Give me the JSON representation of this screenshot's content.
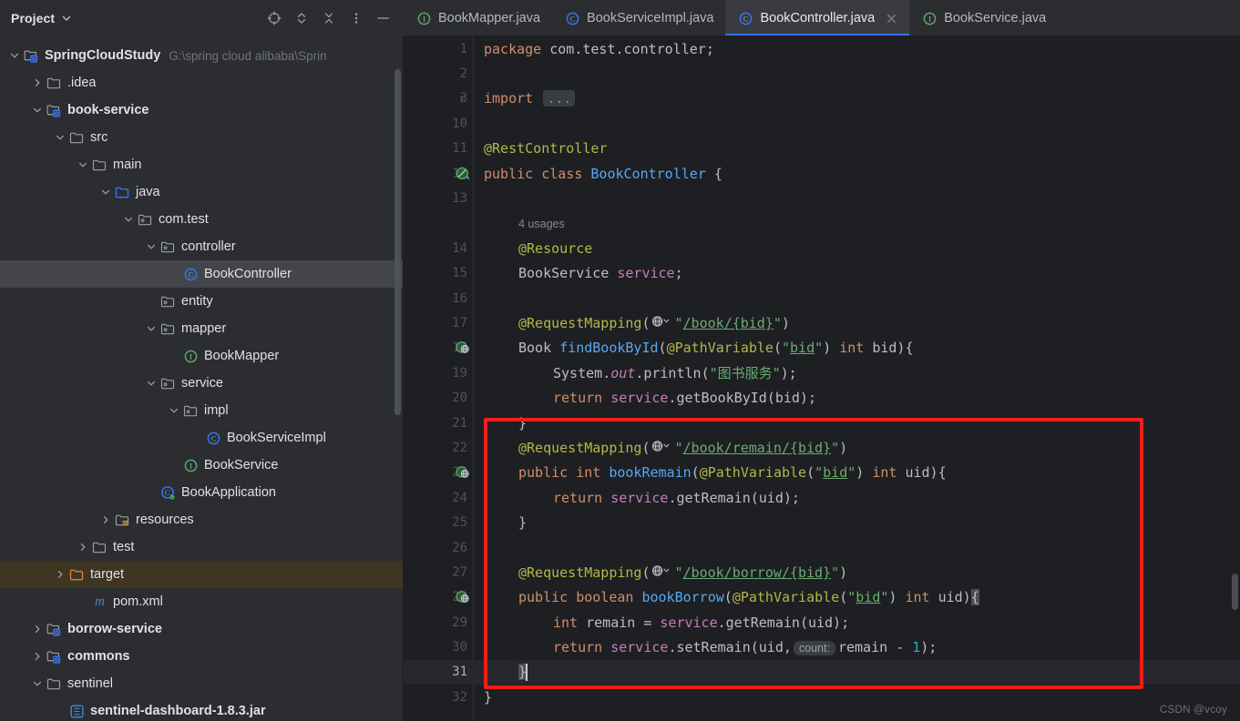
{
  "window": {
    "theme_bg": "#2b2d30",
    "editor_bg": "#1e1f22",
    "accent": "#3574f0",
    "annotation_color": "#ff1a1a"
  },
  "project_panel": {
    "title": "Project",
    "toolbar": [
      {
        "name": "locate-icon",
        "label": "Select Opened File"
      },
      {
        "name": "expand-collapse-icon",
        "label": "Expand/Collapse"
      },
      {
        "name": "collapse-all-icon",
        "label": "Collapse All"
      },
      {
        "name": "more-options-icon",
        "label": "Options"
      },
      {
        "name": "minimize-icon",
        "label": "Hide"
      }
    ],
    "tree": [
      {
        "label": "SpringCloudStudy",
        "sub": "G:\\spring cloud alibaba\\Sprin",
        "depth": 0,
        "icon": "module-icon",
        "arrow": "down",
        "bold": true,
        "state": "normal"
      },
      {
        "label": ".idea",
        "sub": "",
        "depth": 1,
        "icon": "folder-icon",
        "arrow": "right",
        "bold": false,
        "state": "normal"
      },
      {
        "label": "book-service",
        "sub": "",
        "depth": 1,
        "icon": "module-icon",
        "arrow": "down",
        "bold": true,
        "state": "normal"
      },
      {
        "label": "src",
        "sub": "",
        "depth": 2,
        "icon": "folder-icon",
        "arrow": "down",
        "bold": false,
        "state": "normal"
      },
      {
        "label": "main",
        "sub": "",
        "depth": 3,
        "icon": "folder-icon",
        "arrow": "down",
        "bold": false,
        "state": "normal"
      },
      {
        "label": "java",
        "sub": "",
        "depth": 4,
        "icon": "source-folder-icon",
        "arrow": "down",
        "bold": false,
        "state": "normal"
      },
      {
        "label": "com.test",
        "sub": "",
        "depth": 5,
        "icon": "package-icon",
        "arrow": "down",
        "bold": false,
        "state": "normal"
      },
      {
        "label": "controller",
        "sub": "",
        "depth": 6,
        "icon": "package-icon",
        "arrow": "down",
        "bold": false,
        "state": "normal"
      },
      {
        "label": "BookController",
        "sub": "",
        "depth": 7,
        "icon": "class-icon",
        "arrow": "none",
        "bold": false,
        "state": "selected"
      },
      {
        "label": "entity",
        "sub": "",
        "depth": 6,
        "icon": "package-icon",
        "arrow": "none",
        "bold": false,
        "state": "normal"
      },
      {
        "label": "mapper",
        "sub": "",
        "depth": 6,
        "icon": "package-icon",
        "arrow": "down",
        "bold": false,
        "state": "normal"
      },
      {
        "label": "BookMapper",
        "sub": "",
        "depth": 7,
        "icon": "interface-icon",
        "arrow": "none",
        "bold": false,
        "state": "normal"
      },
      {
        "label": "service",
        "sub": "",
        "depth": 6,
        "icon": "package-icon",
        "arrow": "down",
        "bold": false,
        "state": "normal"
      },
      {
        "label": "impl",
        "sub": "",
        "depth": 7,
        "icon": "package-icon",
        "arrow": "down",
        "bold": false,
        "state": "normal"
      },
      {
        "label": "BookServiceImpl",
        "sub": "",
        "depth": 8,
        "icon": "class-icon",
        "arrow": "none",
        "bold": false,
        "state": "normal"
      },
      {
        "label": "BookService",
        "sub": "",
        "depth": 7,
        "icon": "interface-icon",
        "arrow": "none",
        "bold": false,
        "state": "normal"
      },
      {
        "label": "BookApplication",
        "sub": "",
        "depth": 6,
        "icon": "spring-class-icon",
        "arrow": "none",
        "bold": false,
        "state": "normal"
      },
      {
        "label": "resources",
        "sub": "",
        "depth": 4,
        "icon": "resource-folder-icon",
        "arrow": "right",
        "bold": false,
        "state": "normal"
      },
      {
        "label": "test",
        "sub": "",
        "depth": 3,
        "icon": "folder-icon",
        "arrow": "right",
        "bold": false,
        "state": "normal"
      },
      {
        "label": "target",
        "sub": "",
        "depth": 2,
        "icon": "excluded-folder-icon",
        "arrow": "right",
        "bold": false,
        "state": "marked"
      },
      {
        "label": "pom.xml",
        "sub": "",
        "depth": 3,
        "icon": "maven-icon",
        "arrow": "none",
        "bold": false,
        "state": "normal"
      },
      {
        "label": "borrow-service",
        "sub": "",
        "depth": 1,
        "icon": "module-icon",
        "arrow": "right",
        "bold": true,
        "state": "normal"
      },
      {
        "label": "commons",
        "sub": "",
        "depth": 1,
        "icon": "module-icon",
        "arrow": "right",
        "bold": true,
        "state": "normal"
      },
      {
        "label": "sentinel",
        "sub": "",
        "depth": 1,
        "icon": "folder-icon",
        "arrow": "down",
        "bold": false,
        "state": "normal"
      },
      {
        "label": "sentinel-dashboard-1.8.3.jar",
        "sub": "",
        "depth": 2,
        "icon": "jar-icon",
        "arrow": "none",
        "bold": true,
        "state": "normal"
      }
    ]
  },
  "editor_tabs": [
    {
      "label": "BookMapper.java",
      "icon": "interface-icon",
      "active": false,
      "closable": false
    },
    {
      "label": "BookServiceImpl.java",
      "icon": "class-icon",
      "active": false,
      "closable": false
    },
    {
      "label": "BookController.java",
      "icon": "class-icon",
      "active": true,
      "closable": true
    },
    {
      "label": "BookService.java",
      "icon": "interface-icon",
      "active": false,
      "closable": false
    }
  ],
  "code": {
    "filename": "BookController.java",
    "lines": [
      {
        "num": "1",
        "gutter_icon": "",
        "indent": 0,
        "html": "<span class='kw'>package</span> <span class='pkg'>com.test.controller</span>;"
      },
      {
        "num": "2",
        "gutter_icon": "",
        "indent": 0,
        "html": ""
      },
      {
        "num": "3",
        "gutter_icon": "",
        "indent": 0,
        "fold": true,
        "html": "<span class='kw'>import</span> <span class='fold-ph'>...</span>"
      },
      {
        "num": "10",
        "gutter_icon": "",
        "indent": 0,
        "html": ""
      },
      {
        "num": "11",
        "gutter_icon": "",
        "indent": 0,
        "html": "<span class='ann'>@RestController</span>"
      },
      {
        "num": "12",
        "gutter_icon": "bean",
        "indent": 0,
        "html": "<span class='kw'>public</span> <span class='kw'>class</span> <span class='mth'>BookController</span> {"
      },
      {
        "num": "13",
        "gutter_icon": "",
        "indent": 0,
        "html": ""
      },
      {
        "num": "",
        "gutter_icon": "",
        "indent": 1,
        "html": "<span class='usages'>4 usages</span>"
      },
      {
        "num": "14",
        "gutter_icon": "",
        "indent": 1,
        "html": "<span class='ann'>@Resource</span>"
      },
      {
        "num": "15",
        "gutter_icon": "",
        "indent": 1,
        "html": "<span class='typ'>BookService</span> <span class='fld'>service</span>;"
      },
      {
        "num": "16",
        "gutter_icon": "",
        "indent": 1,
        "html": ""
      },
      {
        "num": "17",
        "gutter_icon": "",
        "indent": 1,
        "html": "<span class='ann'>@RequestMapping</span>(<span class='globe'></span><span class='str'>\"</span><span class='url'>/book/{bid}</span><span class='str'>\"</span>)"
      },
      {
        "num": "18",
        "gutter_icon": "web",
        "indent": 1,
        "html": "<span class='typ'>Book</span> <span class='mth'>findBookById</span>(<span class='ann'>@PathVariable</span>(<span class='str'>\"</span><span class='str' style='text-decoration:underline'>bid</span><span class='str'>\"</span>) <span class='kw'>int</span> bid){"
      },
      {
        "num": "19",
        "gutter_icon": "",
        "indent": 2,
        "html": "<span class='typ'>System</span>.<span class='itl'>out</span>.<span class='typ'>println</span>(<span class='str'>\"图书服务\"</span>);"
      },
      {
        "num": "20",
        "gutter_icon": "",
        "indent": 2,
        "html": "<span class='kw'>return</span> <span class='fld'>service</span>.<span class='typ'>getBookById</span>(bid);"
      },
      {
        "num": "21",
        "gutter_icon": "",
        "indent": 1,
        "html": "}"
      },
      {
        "num": "22",
        "gutter_icon": "",
        "indent": 1,
        "html": "<span class='ann'>@RequestMapping</span>(<span class='globe'></span><span class='str'>\"</span><span class='url'>/book/remain/{bid}</span><span class='str'>\"</span>)"
      },
      {
        "num": "23",
        "gutter_icon": "web",
        "indent": 1,
        "html": "<span class='kw'>public</span> <span class='kw'>int</span> <span class='mth'>bookRemain</span>(<span class='ann'>@PathVariable</span>(<span class='str'>\"</span><span class='str' style='text-decoration:underline'>bid</span><span class='str'>\"</span>) <span class='kw'>int</span> uid){"
      },
      {
        "num": "24",
        "gutter_icon": "",
        "indent": 2,
        "html": "<span class='kw'>return</span> <span class='fld'>service</span>.<span class='typ'>getRemain</span>(uid);"
      },
      {
        "num": "25",
        "gutter_icon": "",
        "indent": 1,
        "html": "}"
      },
      {
        "num": "26",
        "gutter_icon": "",
        "indent": 1,
        "html": ""
      },
      {
        "num": "27",
        "gutter_icon": "",
        "indent": 1,
        "html": "<span class='ann'>@RequestMapping</span>(<span class='globe'></span><span class='str'>\"</span><span class='url'>/book/borrow/{bid}</span><span class='str'>\"</span>)"
      },
      {
        "num": "28",
        "gutter_icon": "web",
        "indent": 1,
        "html": "<span class='kw'>public</span> <span class='kw'>boolean</span> <span class='mth'>bookBorrow</span>(<span class='ann'>@PathVariable</span>(<span class='str'>\"</span><span class='str' style='text-decoration:underline'>bid</span><span class='str'>\"</span>) <span class='kw'>int</span> uid)<span class='brace-hl'>{</span>"
      },
      {
        "num": "29",
        "gutter_icon": "",
        "indent": 2,
        "html": "<span class='kw'>int</span> remain = <span class='fld'>service</span>.<span class='typ'>getRemain</span>(uid);"
      },
      {
        "num": "30",
        "gutter_icon": "",
        "indent": 2,
        "html": "<span class='kw'>return</span> <span class='fld'>service</span>.<span class='typ'>setRemain</span>(uid,<span class='inlay'>count:</span>remain - <span class='num'>1</span>);"
      },
      {
        "num": "31",
        "gutter_icon": "",
        "indent": 1,
        "current": true,
        "html": "<span class='brace-hl'>}</span><span class='caret'></span>"
      },
      {
        "num": "32",
        "gutter_icon": "",
        "indent": 0,
        "html": "}"
      }
    ]
  },
  "annotation": {
    "type": "red-rectangle",
    "color": "#ff1a1a",
    "covers_lines": "21-31"
  },
  "watermark": "CSDN @vcoy"
}
